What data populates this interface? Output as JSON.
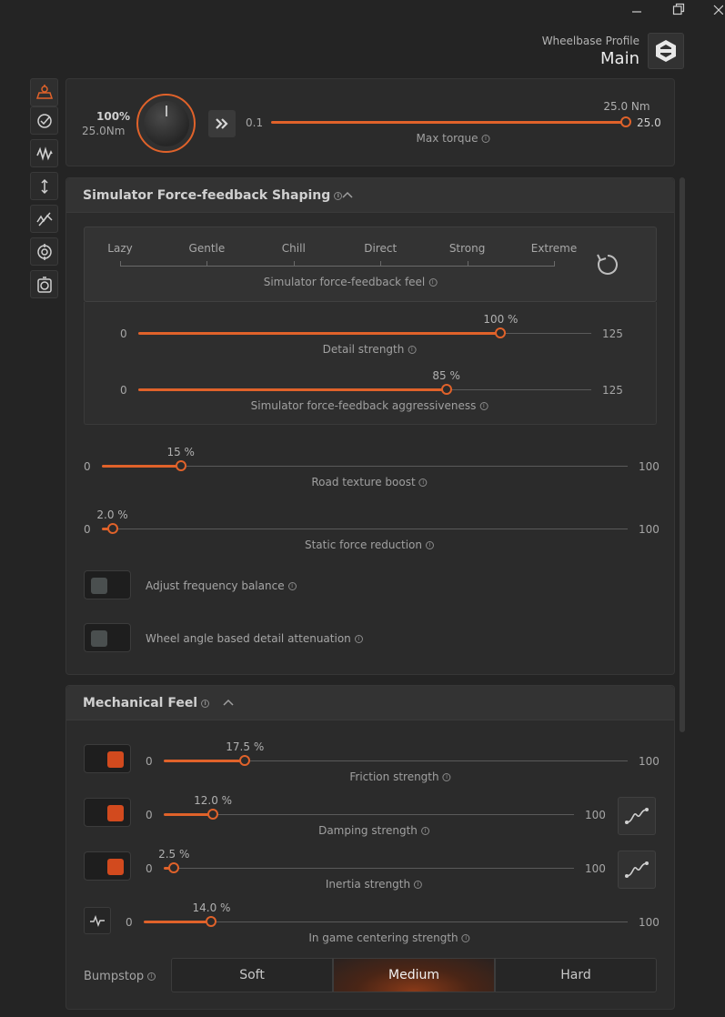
{
  "window": {
    "minimize_icon": "minimize-icon",
    "restore_icon": "restore-icon",
    "close_icon": "close-icon"
  },
  "profile": {
    "label": "Wheelbase Profile",
    "value": "Main"
  },
  "sidebar": {
    "items": [
      {
        "icon": "wheelbase-icon",
        "active": true
      },
      {
        "icon": "gauge-check-icon"
      },
      {
        "icon": "waveform-icon"
      },
      {
        "icon": "vertical-arrows-icon"
      },
      {
        "icon": "muted-signal-icon"
      },
      {
        "icon": "target-icon"
      },
      {
        "icon": "timer-icon"
      }
    ]
  },
  "torque": {
    "percent": "100%",
    "nm": "25.0Nm",
    "min": "0.1",
    "max": "25.0",
    "current": "25.0 Nm",
    "label": "Max torque",
    "fraction": 1.0
  },
  "shaping": {
    "title": "Simulator Force-feedback Shaping",
    "feel": {
      "options": [
        "Lazy",
        "Gentle",
        "Chill",
        "Direct",
        "Strong",
        "Extreme"
      ],
      "label": "Simulator force-feedback feel"
    },
    "detail": {
      "min": "0",
      "max": "125",
      "value": "100 %",
      "label": "Detail strength",
      "fraction": 0.8
    },
    "aggressiveness": {
      "min": "0",
      "max": "125",
      "value": "85 %",
      "label": "Simulator force-feedback aggressiveness",
      "fraction": 0.68
    },
    "road": {
      "min": "0",
      "max": "100",
      "value": "15 %",
      "label": "Road texture boost",
      "fraction": 0.15
    },
    "static": {
      "min": "0",
      "max": "100",
      "value": "2.0 %",
      "label": "Static force reduction",
      "fraction": 0.02
    },
    "freq_balance": {
      "label": "Adjust frequency balance",
      "on": false
    },
    "angle_atten": {
      "label": "Wheel angle based detail attenuation",
      "on": false
    }
  },
  "mechanical": {
    "title": "Mechanical Feel",
    "friction": {
      "min": "0",
      "max": "100",
      "value": "17.5 %",
      "label": "Friction strength",
      "fraction": 0.175
    },
    "damping": {
      "min": "0",
      "max": "100",
      "value": "12.0 %",
      "label": "Damping strength",
      "fraction": 0.12
    },
    "inertia": {
      "min": "0",
      "max": "100",
      "value": "2.5 %",
      "label": "Inertia strength",
      "fraction": 0.025
    },
    "centering": {
      "min": "0",
      "max": "100",
      "value": "14.0 %",
      "label": "In game centering strength",
      "fraction": 0.14
    },
    "bumpstop": {
      "label": "Bumpstop",
      "options": [
        "Soft",
        "Medium",
        "Hard"
      ],
      "selected": "Medium"
    }
  },
  "colors": {
    "accent": "#e0622a",
    "background": "#242424",
    "panel": "#2b2b2b"
  }
}
